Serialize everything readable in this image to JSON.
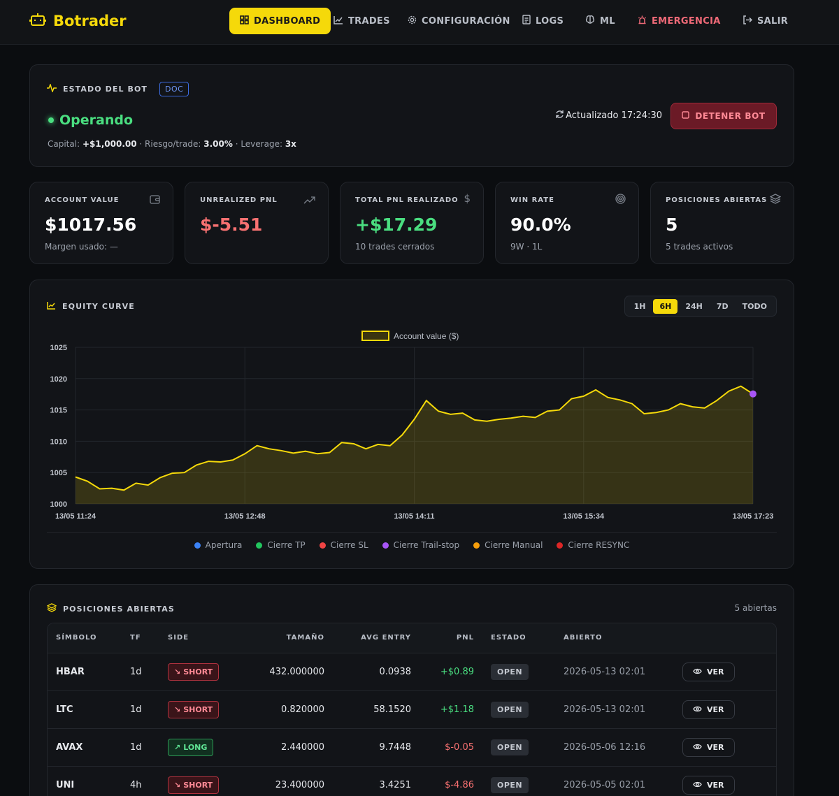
{
  "nav": {
    "brand": "Botrader",
    "items": [
      {
        "label": "DASHBOARD",
        "icon": "grid-icon"
      },
      {
        "label": "TRADES",
        "icon": "chart-line-icon"
      },
      {
        "label": "CONFIGURACIÓN",
        "icon": "gear-icon"
      },
      {
        "label": "LOGS",
        "icon": "document-icon"
      },
      {
        "label": "ML",
        "icon": "brain-icon"
      },
      {
        "label": "EMERGENCIA",
        "icon": "siren-icon"
      },
      {
        "label": "SALIR",
        "icon": "logout-icon"
      }
    ]
  },
  "bot": {
    "title": "ESTADO DEL BOT",
    "doc": "DOC",
    "status": "Operando",
    "capital_label": "Capital:",
    "capital": "+$1,000.00",
    "risk_label": "· Riesgo/trade:",
    "risk": "3.00%",
    "leverage_label": "· Leverage:",
    "leverage": "3x",
    "updated": "Actualizado 17:24:30",
    "stop_label": "DETENER BOT"
  },
  "stats": [
    {
      "label": "ACCOUNT VALUE",
      "value": "$1017.56",
      "sub": "Margen usado: —",
      "icon": "wallet-icon"
    },
    {
      "label": "UNREALIZED PNL",
      "value": "$-5.51",
      "sub": "",
      "icon": "trend-up-icon"
    },
    {
      "label": "TOTAL PNL REALIZADO",
      "value": "+$17.29",
      "sub": "10 trades cerrados",
      "icon": "dollar-icon"
    },
    {
      "label": "WIN RATE",
      "value": "90.0%",
      "sub": "9W · 1L",
      "icon": "target-icon"
    },
    {
      "label": "POSICIONES ABIERTAS",
      "value": "5",
      "sub": "5 trades activos",
      "icon": "layers-icon"
    }
  ],
  "colors": {
    "accent": "#f5d90a",
    "positive": "#4ade80",
    "negative": "#f87171",
    "trail": "#a855f7"
  },
  "equity": {
    "title": "EQUITY CURVE",
    "ranges": [
      "1H",
      "6H",
      "24H",
      "7D",
      "TODO"
    ],
    "active_range": "6H",
    "legend": [
      {
        "label": "Apertura",
        "color": "#3b82f6"
      },
      {
        "label": "Cierre TP",
        "color": "#22c55e"
      },
      {
        "label": "Cierre SL",
        "color": "#ef4444"
      },
      {
        "label": "Cierre Trail-stop",
        "color": "#a855f7"
      },
      {
        "label": "Cierre Manual",
        "color": "#f59e0b"
      },
      {
        "label": "Cierre RESYNC",
        "color": "#dc2626"
      }
    ]
  },
  "chart_data": {
    "type": "area",
    "title": "",
    "xlabel": "",
    "ylabel": "",
    "series": [
      {
        "name": "Account value ($)",
        "color": "#f5d90a"
      }
    ],
    "xticks": [
      "13/05 11:24",
      "13/05 12:48",
      "13/05 14:11",
      "13/05 15:34",
      "13/05 17:23"
    ],
    "ylim": [
      1000,
      1025
    ],
    "yticks": [
      1000,
      1005,
      1010,
      1015,
      1020,
      1025
    ],
    "grid": true,
    "legend": "top-center",
    "values": [
      1004.3,
      1003.6,
      1002.4,
      1002.5,
      1002.2,
      1003.3,
      1003.0,
      1004.2,
      1004.9,
      1005.0,
      1006.2,
      1006.8,
      1006.7,
      1007.0,
      1008.0,
      1009.3,
      1008.8,
      1008.5,
      1008.1,
      1008.4,
      1008.0,
      1008.2,
      1009.8,
      1009.6,
      1008.8,
      1009.5,
      1009.3,
      1011.0,
      1013.5,
      1016.5,
      1014.8,
      1014.3,
      1014.5,
      1013.4,
      1013.2,
      1013.5,
      1013.7,
      1014.0,
      1013.8,
      1014.8,
      1015.0,
      1016.8,
      1017.2,
      1018.2,
      1017.0,
      1016.6,
      1016.0,
      1014.4,
      1014.6,
      1015.0,
      1016.0,
      1015.5,
      1015.3,
      1016.5,
      1018.0,
      1018.8,
      1017.56
    ],
    "last_marker": {
      "value": 1017.56,
      "type": "Cierre Trail-stop"
    }
  },
  "positions": {
    "title": "POSICIONES ABIERTAS",
    "count": "5 abiertas",
    "columns": [
      "SÍMBOLO",
      "TF",
      "SIDE",
      "TAMAÑO",
      "AVG ENTRY",
      "PNL",
      "ESTADO",
      "ABIERTO",
      ""
    ],
    "rows": [
      {
        "symbol": "HBAR",
        "tf": "1d",
        "side": "SHORT",
        "size": "432.000000",
        "entry": "0.0938",
        "pnl": "+$0.89",
        "status": "OPEN",
        "opened": "2026-05-13 02:01",
        "action": "VER"
      },
      {
        "symbol": "LTC",
        "tf": "1d",
        "side": "SHORT",
        "size": "0.820000",
        "entry": "58.1520",
        "pnl": "+$1.18",
        "status": "OPEN",
        "opened": "2026-05-13 02:01",
        "action": "VER"
      },
      {
        "symbol": "AVAX",
        "tf": "1d",
        "side": "LONG",
        "size": "2.440000",
        "entry": "9.7448",
        "pnl": "$-0.05",
        "status": "OPEN",
        "opened": "2026-05-06 12:16",
        "action": "VER"
      },
      {
        "symbol": "UNI",
        "tf": "4h",
        "side": "SHORT",
        "size": "23.400000",
        "entry": "3.4251",
        "pnl": "$-4.86",
        "status": "OPEN",
        "opened": "2026-05-05 02:01",
        "action": "VER"
      }
    ]
  }
}
